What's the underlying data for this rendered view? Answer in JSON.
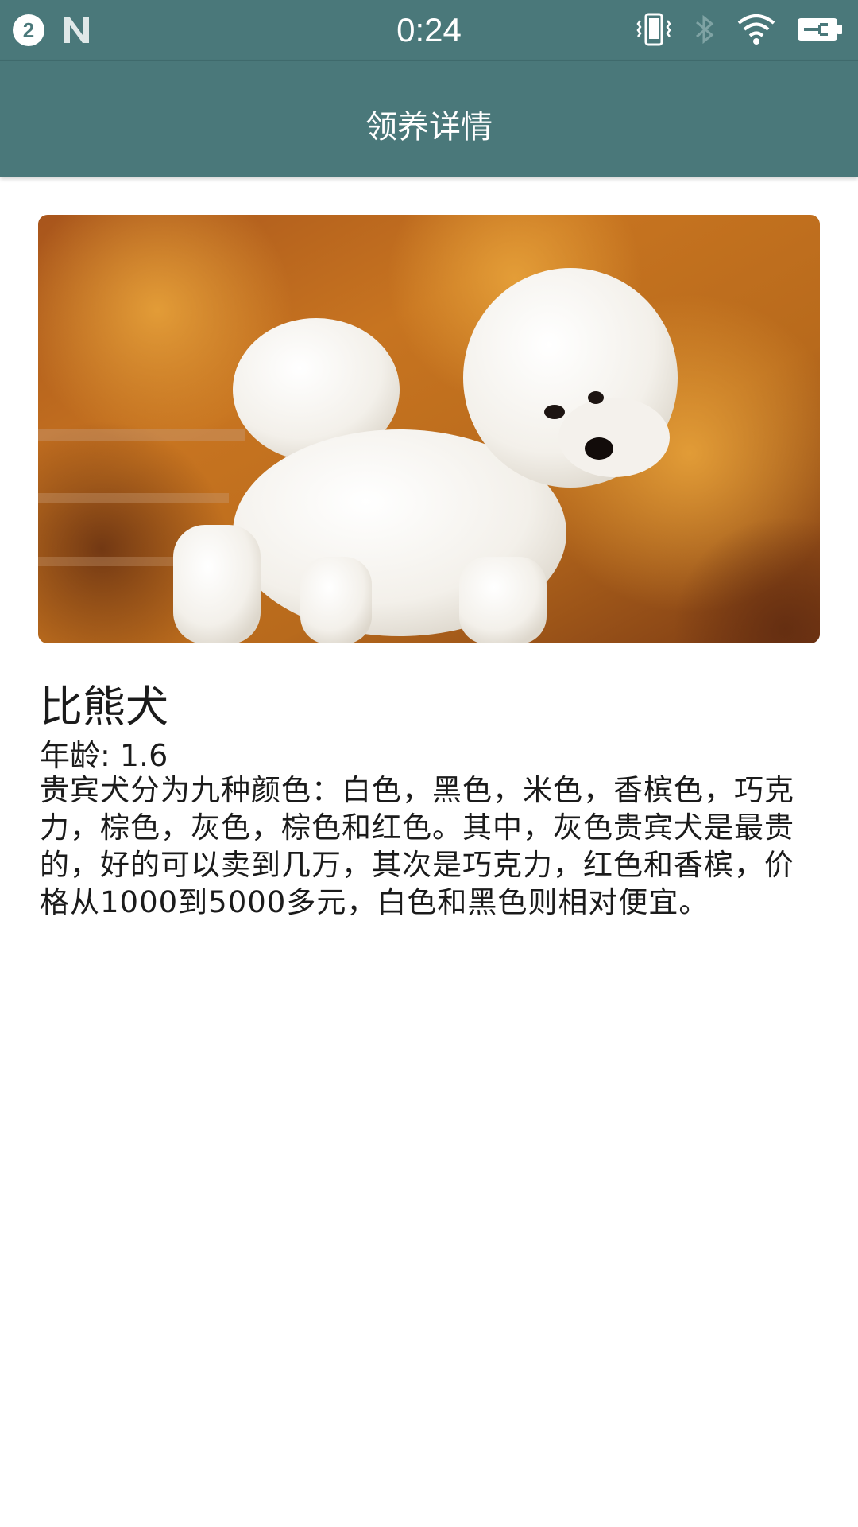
{
  "status_bar": {
    "notification_count": "2",
    "time": "0:24",
    "icons": [
      "notification-count-icon",
      "n-logo-icon",
      "vibrate-icon",
      "bluetooth-icon",
      "wifi-icon",
      "battery-charging-icon"
    ]
  },
  "app_bar": {
    "title": "领养详情"
  },
  "pet": {
    "name": "比熊犬",
    "age_label": "年龄: 1.6",
    "description": "贵宾犬分为九种颜色：白色，黑色，米色，香槟色，巧克力，棕色，灰色，棕色和红色。其中，灰色贵宾犬是最贵的，好的可以卖到几万，其次是巧克力，红色和香槟，价格从1000到5000多元，白色和黑色则相对便宜。"
  },
  "colors": {
    "primary": "#4a787a",
    "text": "#1b1b1b",
    "background": "#ffffff"
  }
}
